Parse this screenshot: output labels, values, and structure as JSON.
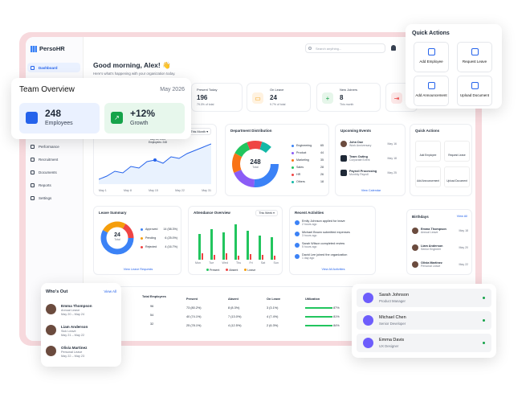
{
  "app": {
    "name": "PersoHR"
  },
  "sidebar": {
    "items": [
      {
        "label": "Dashboard",
        "icon": "home-icon",
        "active": true
      },
      {
        "label": "Performance",
        "icon": "chart-icon"
      },
      {
        "label": "Recruitment",
        "icon": "briefcase-icon"
      },
      {
        "label": "Documents",
        "icon": "file-icon"
      },
      {
        "label": "Reports",
        "icon": "report-icon"
      },
      {
        "label": "Settings",
        "icon": "gear-icon"
      }
    ]
  },
  "header": {
    "greeting": "Good morning, Alex! 👋",
    "subtitle": "Here's what's happening with your organization today.",
    "search_placeholder": "Search anything..."
  },
  "stats": [
    {
      "label": "Present Today",
      "value": "196",
      "sub": "79.0% of total"
    },
    {
      "label": "On Leave",
      "value": "24",
      "sub": "9.7% of total"
    },
    {
      "label": "New Joiners",
      "value": "8",
      "sub": "This month"
    }
  ],
  "team_overview": {
    "title": "Team Overview",
    "period": "May 2026",
    "employees_value": "248",
    "employees_label": "Employees",
    "growth_value": "+12%",
    "growth_label": "Growth"
  },
  "growth_chart": {
    "filter": "This Month",
    "tooltip_date": "May 15, 2024",
    "tooltip_label": "Employees: 248",
    "x_labels": [
      "May 1",
      "May 8",
      "May 15",
      "May 22",
      "May 31"
    ]
  },
  "department": {
    "title": "Department Distribution",
    "total": "248",
    "total_label": "Total",
    "items": [
      {
        "name": "Engineering",
        "value": "65",
        "color": "#3b82f6"
      },
      {
        "name": "Product",
        "value": "44",
        "color": "#8b5cf6"
      },
      {
        "name": "Marketing",
        "value": "35",
        "color": "#f97316"
      },
      {
        "name": "Sales",
        "value": "28",
        "color": "#22c55e"
      },
      {
        "name": "HR",
        "value": "26",
        "color": "#ef4444"
      },
      {
        "name": "Others",
        "value": "18",
        "color": "#14b8a6"
      }
    ]
  },
  "events": {
    "title": "Upcoming Events",
    "items": [
      {
        "name": "John Doe",
        "desc": "Work Anniversary",
        "date": "May 16"
      },
      {
        "name": "Team Outing",
        "desc": "Corporate Event",
        "date": "May 18"
      },
      {
        "name": "Payroll Processing",
        "desc": "Monthly Payroll",
        "date": "May 25"
      }
    ],
    "link": "View Calendar"
  },
  "quick_actions_small": {
    "title": "Quick Actions",
    "items": [
      "Add Employee",
      "Request Leave",
      "Add Announcement",
      "Upload Document"
    ]
  },
  "quick_actions": {
    "title": "Quick Actions",
    "items": [
      {
        "label": "Add Employee",
        "icon": "add-user-icon"
      },
      {
        "label": "Request Leave",
        "icon": "calendar-icon"
      },
      {
        "label": "Add Announcement",
        "icon": "megaphone-icon"
      },
      {
        "label": "Upload Document",
        "icon": "upload-document-icon"
      }
    ]
  },
  "leave_summary": {
    "title": "Leave Summary",
    "total": "24",
    "total_label": "Total",
    "items": [
      {
        "name": "Approved",
        "value": "14 (58.3%)",
        "color": "#3b82f6"
      },
      {
        "name": "Pending",
        "value": "6 (25.0%)",
        "color": "#f59e0b"
      },
      {
        "name": "Rejected",
        "value": "4 (16.7%)",
        "color": "#ef4444"
      }
    ],
    "link": "View Leave Requests"
  },
  "attendance": {
    "title": "Attendance Overview",
    "filter": "This Week",
    "legend": [
      "Present",
      "Absent",
      "Leave"
    ],
    "days": [
      "Mon",
      "Tue",
      "Wed",
      "Thu",
      "Fri",
      "Sat",
      "Sun"
    ]
  },
  "activities": {
    "title": "Recent Activities",
    "items": [
      {
        "text": "Emily Johnson applied for leave",
        "time": "2 hours ago"
      },
      {
        "text": "Michael Brown submitted expenses",
        "time": "3 hours ago"
      },
      {
        "text": "Sarah Wilson completed review",
        "time": "5 hours ago"
      },
      {
        "text": "David Lee joined the organization",
        "time": "1 day ago"
      }
    ],
    "link": "View All Activities"
  },
  "birthdays": {
    "title": "Birthdays",
    "link": "View All",
    "items": [
      {
        "name": "Emma Thompson",
        "role": "Annual Leave",
        "date": "May 18"
      },
      {
        "name": "Liam Anderson",
        "role": "Senior Engineer",
        "date": "May 20"
      },
      {
        "name": "Olivia Martinez",
        "role": "Personal Leave",
        "date": "May 22"
      }
    ]
  },
  "table": {
    "headers": [
      "Total Employees",
      "Present",
      "Absent",
      "On Leave",
      "Utilization"
    ],
    "rows": [
      [
        "96",
        "73 (80.2%)",
        "8 (8.3%)",
        "3 (3.1%)",
        "87%"
      ],
      [
        "54",
        "40 (74.1%)",
        "7 (13.0%)",
        "4 (7.4%)",
        "81%"
      ],
      [
        "32",
        "25 (78.1%)",
        "4 (12.5%)",
        "2 (6.3%)",
        "84%"
      ]
    ]
  },
  "whos_out": {
    "title": "Who's Out",
    "link": "View All",
    "items": [
      {
        "name": "Emma Thompson",
        "type": "Annual Leave",
        "dates": "May 20 – May 24"
      },
      {
        "name": "Liam Anderson",
        "type": "Sick Leave",
        "dates": "May 21 – May 22"
      },
      {
        "name": "Olivia Martinez",
        "type": "Personal Leave",
        "dates": "May 22 – May 23"
      }
    ]
  },
  "employees": [
    {
      "name": "Sarah Johnson",
      "role": "Product Manager"
    },
    {
      "name": "Michael Chen",
      "role": "Senior Developer"
    },
    {
      "name": "Emma Davis",
      "role": "UX Designer"
    }
  ]
}
